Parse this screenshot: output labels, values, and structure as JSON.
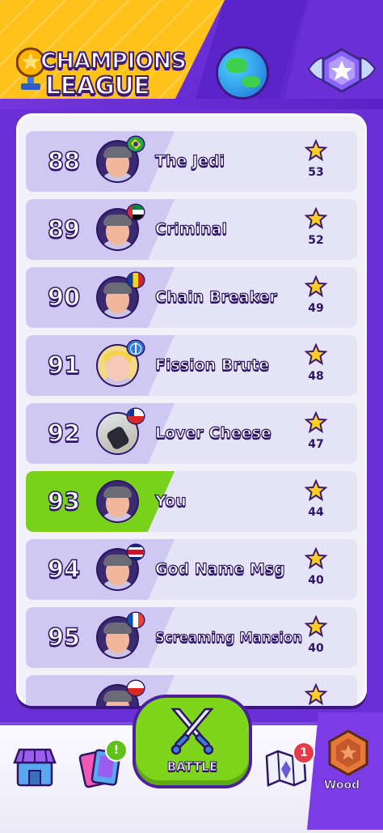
{
  "header": {
    "title_line1": "CHAMPIONS",
    "title_line2": "LEAGUE",
    "tabs": [
      {
        "name": "champions-league",
        "icon": "trophy-icon",
        "selected": true
      },
      {
        "name": "world",
        "icon": "globe-icon",
        "selected": false
      },
      {
        "name": "badge",
        "icon": "star-badge-icon",
        "selected": false
      }
    ]
  },
  "leaderboard": {
    "rows": [
      {
        "rank": "88",
        "name": "The Jedi",
        "score": "53",
        "flag": "Brazil",
        "avatar": "boy-cap"
      },
      {
        "rank": "89",
        "name": "Criminal",
        "score": "52",
        "flag": "UAE",
        "avatar": "boy-cap"
      },
      {
        "rank": "90",
        "name": "Chain Breaker",
        "score": "49",
        "flag": "Romania",
        "avatar": "boy-cap"
      },
      {
        "rank": "91",
        "name": "Fission Brute",
        "score": "48",
        "flag": "World",
        "avatar": "blonde-girl"
      },
      {
        "rank": "92",
        "name": "Lover Cheese",
        "score": "47",
        "flag": "Chile",
        "avatar": "photo"
      },
      {
        "rank": "93",
        "name": "You",
        "score": "44",
        "flag": "",
        "avatar": "boy-cap",
        "highlight": true
      },
      {
        "rank": "94",
        "name": "God Name Msg",
        "score": "40",
        "flag": "Costa Rica",
        "avatar": "boy-cap"
      },
      {
        "rank": "95",
        "name": "Screaming Mansion",
        "score": "40",
        "flag": "France",
        "avatar": "boy-cap"
      }
    ]
  },
  "nav": {
    "items": [
      {
        "name": "shop",
        "icon": "shop-icon"
      },
      {
        "name": "cards",
        "icon": "cards-icon",
        "badge": "!"
      },
      {
        "name": "battle",
        "icon": "crossed-swords-icon",
        "label": "BATTLE"
      },
      {
        "name": "map",
        "icon": "map-icon",
        "badge": "1"
      },
      {
        "name": "league",
        "icon": "wood-badge-icon",
        "label": "Wood"
      }
    ]
  },
  "colors": {
    "primary": "#6b2fd6",
    "accent": "#ffc21a",
    "highlight": "#78d219",
    "text_outline": "#2d1466"
  }
}
